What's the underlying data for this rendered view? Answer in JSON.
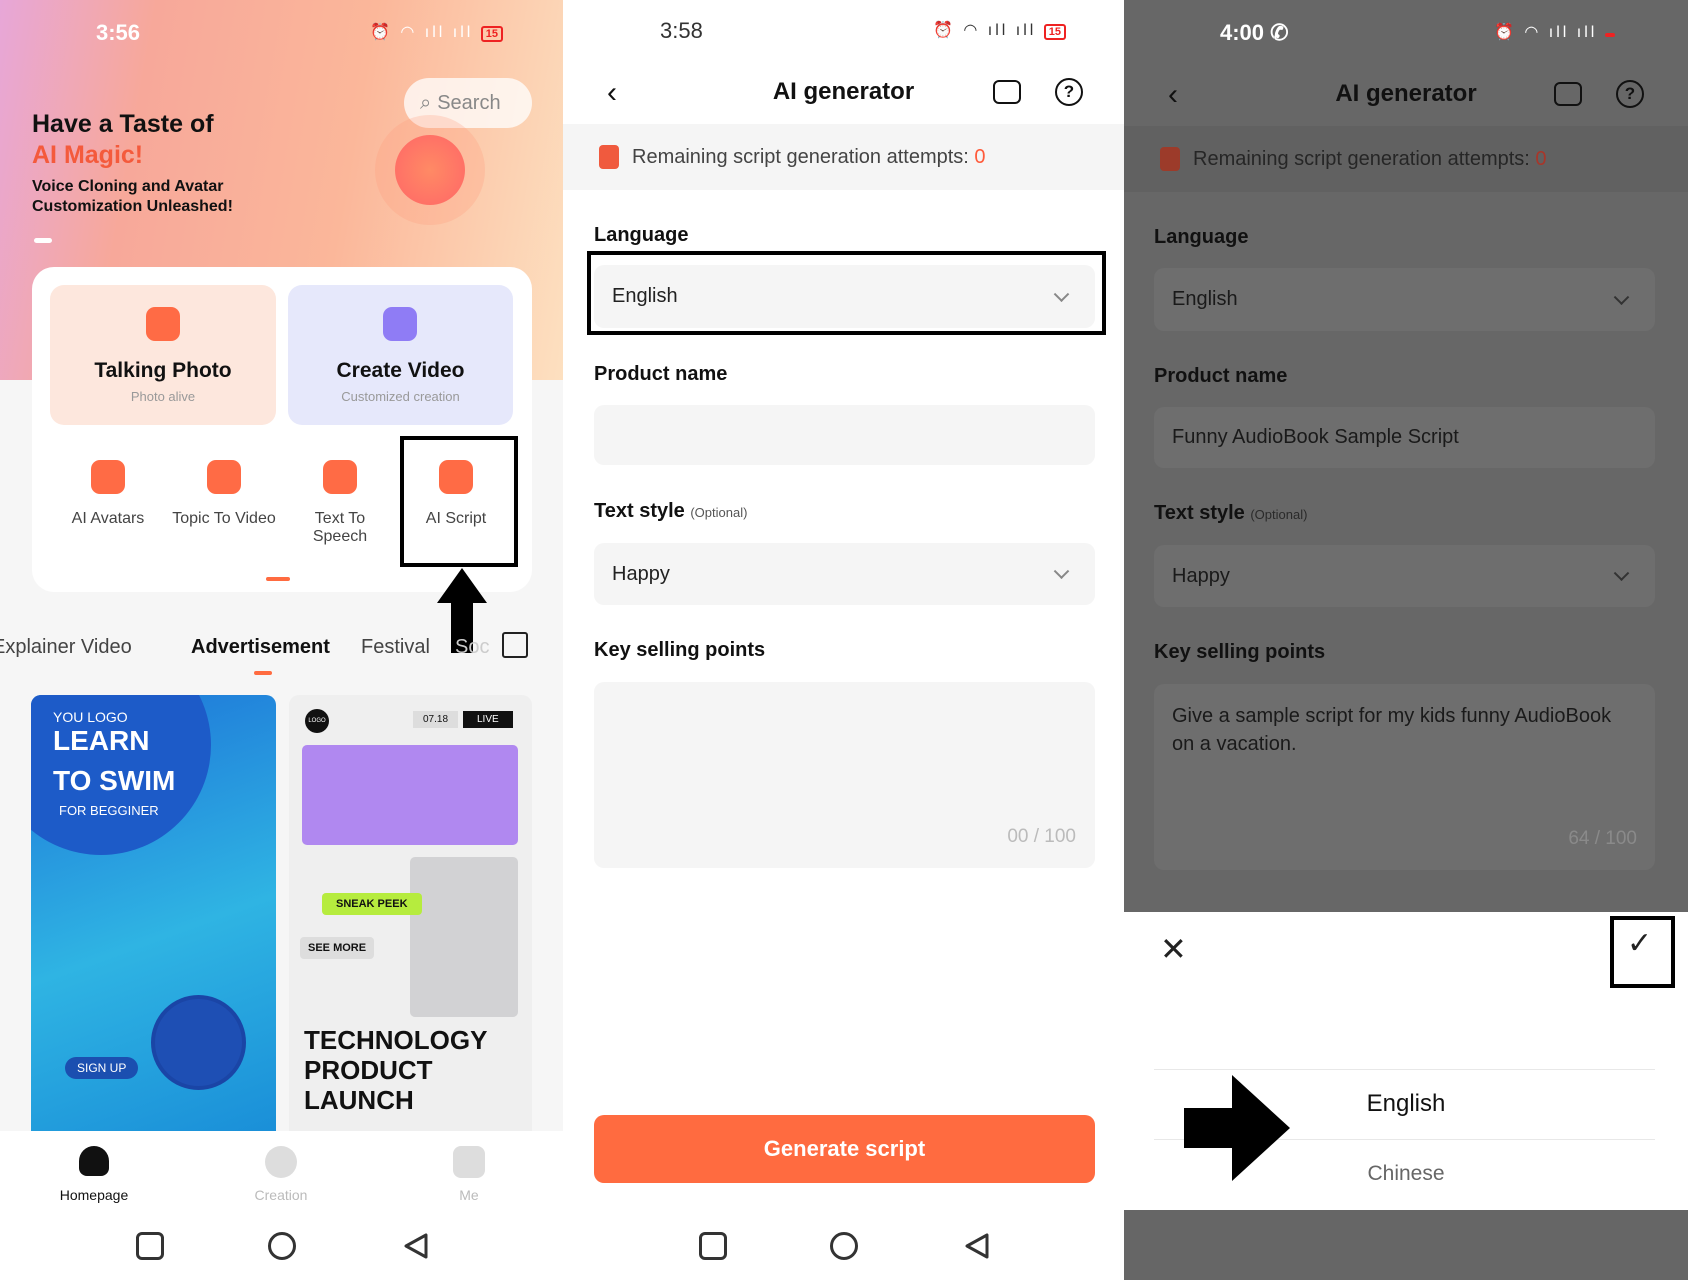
{
  "panel1": {
    "status": {
      "time": "3:56",
      "battery": "15"
    },
    "banner": {
      "title": "Have a Taste of",
      "highlight": "AI Magic!",
      "subtitle1": "Voice Cloning and Avatar",
      "subtitle2": "Customization Unleashed!",
      "search_label": "Search"
    },
    "features": [
      {
        "title": "Talking Photo",
        "subtitle": "Photo alive"
      },
      {
        "title": "Create Video",
        "subtitle": "Customized creation"
      }
    ],
    "tools": [
      "AI Avatars",
      "Topic To Video",
      "Text To Speech",
      "AI Script"
    ],
    "tabs": [
      "Explainer Video",
      "Advertisement",
      "Festival",
      "Soc"
    ],
    "active_tab": "Advertisement",
    "thumb1": {
      "logo": "YOU LOGO",
      "line1": "LEARN",
      "line2": "TO SWIM",
      "line3": "FOR BEGGINER",
      "button": "SIGN UP"
    },
    "thumb2": {
      "logo": "LOGO",
      "date": "07.18",
      "live": "LIVE",
      "tag1": "SNEAK PEEK",
      "tag2": "SEE MORE",
      "line1": "TECHNOLOGY",
      "line2": "PRODUCT",
      "line3": "LAUNCH"
    },
    "nav": [
      "Homepage",
      "Creation",
      "Me"
    ]
  },
  "panel2": {
    "status": {
      "time": "3:58",
      "battery": "15"
    },
    "title": "AI generator",
    "notice": "Remaining script generation attempts:",
    "attempts": "0",
    "language_label": "Language",
    "language_value": "English",
    "product_label": "Product name",
    "product_value": "",
    "style_label": "Text style",
    "optional": "(Optional)",
    "style_value": "Happy",
    "points_label": "Key selling points",
    "points_value": "",
    "counter": "00 / 100",
    "generate": "Generate script"
  },
  "panel3": {
    "status": {
      "time": "4:00"
    },
    "title": "AI generator",
    "notice": "Remaining script generation attempts:",
    "attempts": "0",
    "language_label": "Language",
    "language_value": "English",
    "product_label": "Product name",
    "product_value": "Funny AudioBook Sample Script",
    "style_label": "Text style",
    "optional": "(Optional)",
    "style_value": "Happy",
    "points_label": "Key selling points",
    "points_value": "Give a sample script for my kids funny AudioBook on a vacation.",
    "counter": "64 / 100",
    "picker": {
      "options": [
        "English",
        "Chinese"
      ],
      "selected": "English"
    }
  },
  "colors": {
    "accent": "#ff6b40",
    "highlight": "#000000"
  }
}
